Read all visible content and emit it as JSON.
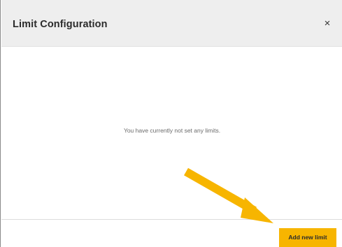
{
  "modal": {
    "title": "Limit Configuration",
    "close_glyph": "×"
  },
  "body": {
    "empty_message": "You have currently not set any limits."
  },
  "footer": {
    "add_button_label": "Add new limit"
  },
  "colors": {
    "accent": "#f7b500",
    "arrow": "#f7b500",
    "header_bg": "#eeeeee"
  },
  "icons": {
    "close": "close-icon",
    "annotation": "arrow-annotation"
  }
}
